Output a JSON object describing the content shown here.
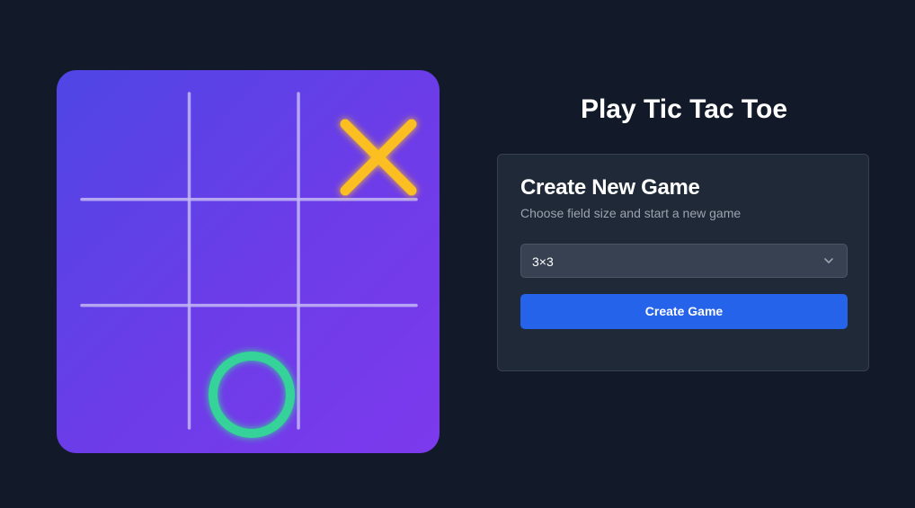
{
  "hero": {
    "board": {
      "rows": 3,
      "cols": 3,
      "cells": [
        [
          "",
          "",
          "X"
        ],
        [
          "",
          "",
          ""
        ],
        [
          "",
          "O",
          ""
        ]
      ]
    },
    "colors": {
      "gradient_start": "#4f46e5",
      "gradient_end": "#7c3aed",
      "grid_lines": "#c4b8f5",
      "x_mark": "#fbbf24",
      "o_mark": "#34d399"
    }
  },
  "page_title": "Play Tic Tac Toe",
  "create_panel": {
    "heading": "Create New Game",
    "subtitle": "Choose field size and start a new game",
    "field_size": {
      "selected": "3×3"
    },
    "create_button_label": "Create Game"
  },
  "colors": {
    "background": "#121a29",
    "panel": "#1f2937",
    "accent": "#2563eb"
  }
}
